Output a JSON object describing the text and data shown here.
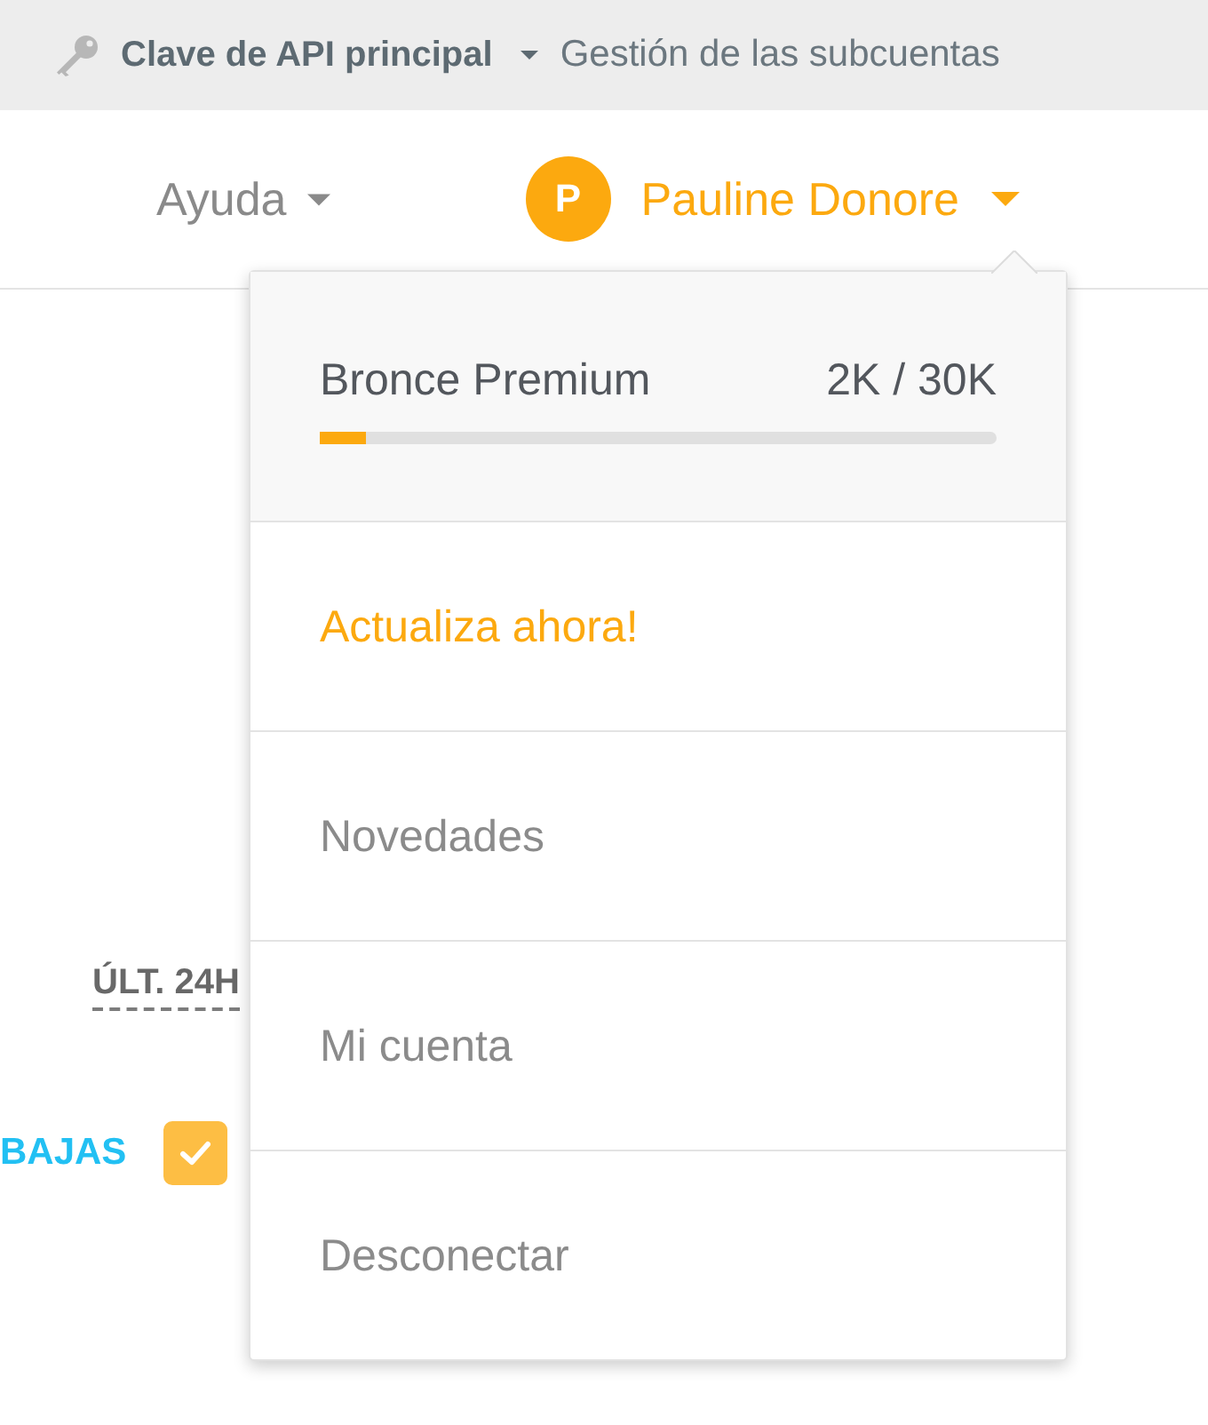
{
  "top_bar": {
    "api_key": {
      "label": "Clave de API principal"
    },
    "subaccounts": {
      "label": "Gestión de las subcuentas"
    }
  },
  "nav": {
    "help": {
      "label": "Ayuda"
    },
    "user": {
      "initial": "P",
      "name": "Pauline Donore",
      "expanded": true
    }
  },
  "user_menu": {
    "plan": {
      "name": "Bronce Premium",
      "usage": "2K / 30K",
      "level": 0.067
    },
    "items": [
      {
        "label": "Actualiza ahora!",
        "kind": "upgrade"
      },
      {
        "label": "Novedades",
        "kind": "link"
      },
      {
        "label": "Mi cuenta",
        "kind": "link"
      },
      {
        "label": "Desconectar",
        "kind": "link"
      }
    ]
  },
  "background": {
    "period_filter": {
      "label": "ÚLT. 24H"
    },
    "filter": {
      "label": "BAJAS",
      "checked": true
    }
  }
}
